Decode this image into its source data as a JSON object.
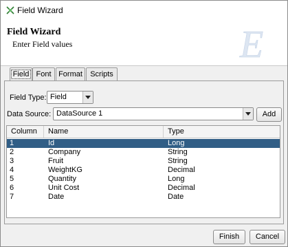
{
  "window": {
    "title": "Field Wizard"
  },
  "header": {
    "title": "Field Wizard",
    "subtitle": "Enter Field values",
    "logo_letter": "E"
  },
  "tabs": [
    {
      "label": "Field",
      "active": true
    },
    {
      "label": "Font",
      "active": false
    },
    {
      "label": "Format",
      "active": false
    },
    {
      "label": "Scripts",
      "active": false
    }
  ],
  "form": {
    "field_type_label": "Field Type:",
    "field_type_value": "Field",
    "data_source_label": "Data Source:",
    "data_source_value": "DataSource 1",
    "add_label": "Add"
  },
  "table": {
    "columns": [
      "Column",
      "Name",
      "Type"
    ],
    "rows": [
      [
        "1",
        "Id",
        "Long"
      ],
      [
        "2",
        "Company",
        "String"
      ],
      [
        "3",
        "Fruit",
        "String"
      ],
      [
        "4",
        "WeightKG",
        "Decimal"
      ],
      [
        "5",
        "Quantity",
        "Long"
      ],
      [
        "6",
        "Unit Cost",
        "Decimal"
      ],
      [
        "7",
        "Date",
        "Date"
      ]
    ],
    "selected_row": 0
  },
  "footer": {
    "finish_label": "Finish",
    "cancel_label": "Cancel"
  },
  "colors": {
    "selection": "#315e86",
    "title_icon": "#2e7d32"
  }
}
